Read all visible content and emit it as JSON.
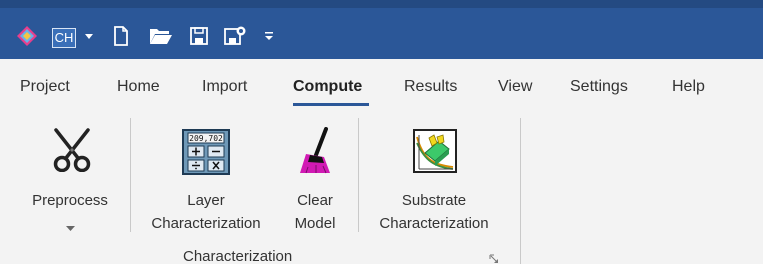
{
  "quick_access": {
    "profile_label": "CH",
    "icons": [
      "app-logo-icon",
      "profile-button",
      "dropdown-arrow-icon",
      "new-file-icon",
      "open-folder-icon",
      "save-icon",
      "save-to-cloud-icon",
      "customize-quick-access-icon"
    ]
  },
  "tabs": [
    {
      "label": "Project"
    },
    {
      "label": "Home"
    },
    {
      "label": "Import"
    },
    {
      "label": "Compute",
      "active": true
    },
    {
      "label": "Results"
    },
    {
      "label": "View"
    },
    {
      "label": "Settings"
    },
    {
      "label": "Help"
    }
  ],
  "ribbon": {
    "preprocess": {
      "label": "Preprocess",
      "icon": "scissors-icon"
    },
    "layer_characterization": {
      "line1": "Layer",
      "line2": "Characterization",
      "icon": "calculator-icon",
      "calculator_display": "209,702"
    },
    "clear_model": {
      "line1": "Clear",
      "line2": "Model",
      "icon": "broom-icon"
    },
    "substrate_characterization": {
      "line1": "Substrate",
      "line2": "Characterization",
      "icon": "substrate-chart-icon"
    },
    "group_label": "Characterization"
  },
  "colors": {
    "titlebar": "#2b5798",
    "ribbon_background": "#f3f3f3",
    "active_tab_underline": "#2b5798"
  }
}
